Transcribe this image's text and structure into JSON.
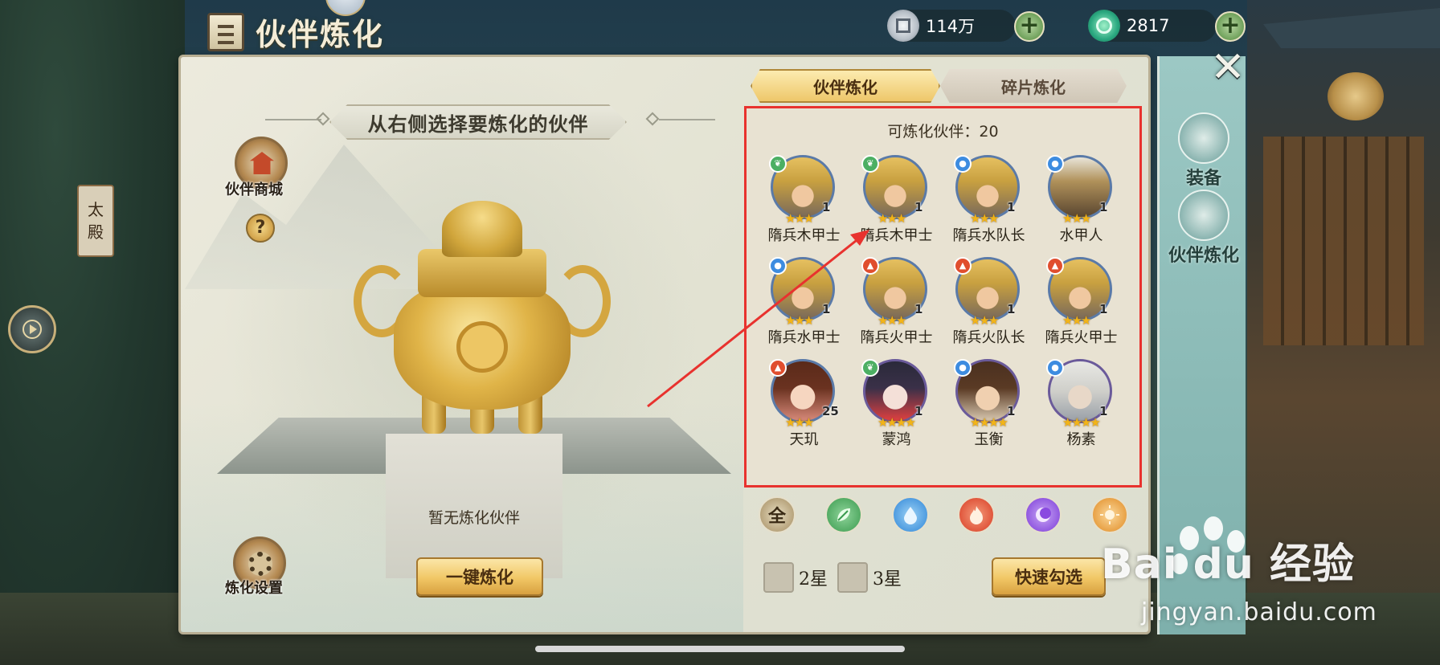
{
  "header": {
    "title": "伙伴炼化",
    "currency_silver": "114万",
    "currency_jade": "2817"
  },
  "background": {
    "banner_chars": [
      "太",
      "殿"
    ]
  },
  "left": {
    "instruction": "从右侧选择要炼化的伙伴",
    "shop_label": "伙伴商城",
    "help_symbol": "?",
    "empty_text": "暂无炼化伙伴",
    "onekey_label": "一键炼化",
    "settings_label": "炼化设置"
  },
  "tabs": [
    {
      "label": "伙伴炼化",
      "active": true
    },
    {
      "label": "碎片炼化",
      "active": false
    }
  ],
  "list": {
    "count_label": "可炼化伙伴：20",
    "partners": [
      {
        "name": "隋兵木甲士",
        "element": "wood",
        "stars": 3,
        "level": "1",
        "face": "soldier"
      },
      {
        "name": "隋兵木甲士",
        "element": "wood",
        "stars": 3,
        "level": "1",
        "face": "soldier"
      },
      {
        "name": "隋兵水队长",
        "element": "water",
        "stars": 3,
        "level": "1",
        "face": "soldier"
      },
      {
        "name": "水甲人",
        "element": "water",
        "stars": 3,
        "level": "1",
        "face": "box"
      },
      {
        "name": "隋兵水甲士",
        "element": "water",
        "stars": 3,
        "level": "1",
        "face": "soldier"
      },
      {
        "name": "隋兵火甲士",
        "element": "fire",
        "stars": 3,
        "level": "1",
        "face": "soldier"
      },
      {
        "name": "隋兵火队长",
        "element": "fire",
        "stars": 3,
        "level": "1",
        "face": "soldier"
      },
      {
        "name": "隋兵火甲士",
        "element": "fire",
        "stars": 3,
        "level": "1",
        "face": "soldier"
      },
      {
        "name": "天玑",
        "element": "fire",
        "stars": 3,
        "level": "25",
        "face": "girl"
      },
      {
        "name": "蒙鸿",
        "element": "wood",
        "stars": 4,
        "level": "1",
        "face": "mask"
      },
      {
        "name": "玉衡",
        "element": "water",
        "stars": 4,
        "level": "1",
        "face": "boy"
      },
      {
        "name": "杨素",
        "element": "water",
        "stars": 4,
        "level": "1",
        "face": "old"
      }
    ]
  },
  "filters": {
    "all": "全",
    "elements": [
      "wood",
      "water",
      "fire",
      "dark",
      "light"
    ]
  },
  "checks": {
    "two_star": "2星",
    "three_star": "3星",
    "quick_select": "快速勾选"
  },
  "side_nav": {
    "equip": "装备",
    "partner_refine": "伙伴炼化",
    "close": "✕"
  },
  "watermark": {
    "brand": "Bai du 经验",
    "url": "jingyan.baidu.com"
  }
}
